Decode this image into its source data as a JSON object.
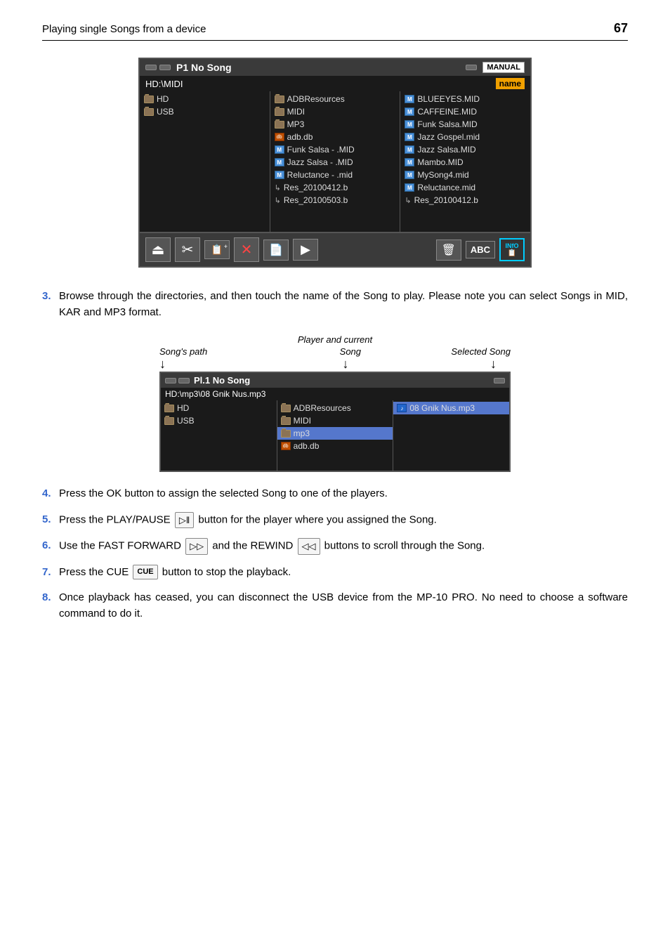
{
  "header": {
    "title": "Playing single Songs from a device",
    "page_number": "67"
  },
  "device_panel": {
    "top_bar": {
      "title": "P1 No Song",
      "manual": "MANUAL"
    },
    "path": "HD:\\MIDI",
    "name_badge": "name",
    "col1": [
      {
        "type": "folder",
        "label": "HD"
      },
      {
        "type": "folder",
        "label": "USB"
      }
    ],
    "col2": [
      {
        "type": "folder",
        "label": "ADBResources"
      },
      {
        "type": "folder",
        "label": "MIDI"
      },
      {
        "type": "folder",
        "label": "MP3"
      },
      {
        "type": "db",
        "label": "adb.db"
      },
      {
        "type": "mid",
        "label": "Funk Salsa - .MID"
      },
      {
        "type": "mid",
        "label": "Jazz Salsa - .MID"
      },
      {
        "type": "mid",
        "label": "Reluctance - .mid"
      },
      {
        "type": "sub",
        "label": "Res_20100412.b"
      },
      {
        "type": "sub",
        "label": "Res_20100503.b"
      }
    ],
    "col3": [
      {
        "type": "mid",
        "label": "BLUEEYES.MID"
      },
      {
        "type": "mid",
        "label": "CAFFEINE.MID"
      },
      {
        "type": "mid",
        "label": "Funk Salsa.MID"
      },
      {
        "type": "mid",
        "label": "Jazz Gospel.mid"
      },
      {
        "type": "mid",
        "label": "Jazz Salsa.MID"
      },
      {
        "type": "mid",
        "label": "Mambo.MID"
      },
      {
        "type": "mid",
        "label": "MySong4.mid"
      },
      {
        "type": "mid",
        "label": "Reluctance.mid"
      },
      {
        "type": "sub",
        "label": "Res_20100412.b"
      }
    ],
    "toolbar": {
      "info_label": "INFO"
    }
  },
  "step3": {
    "number": "3.",
    "text": "Browse through the directories, and then touch the name of the Song to play. Please note you can select Songs in MID, KAR and MP3 format."
  },
  "diagram": {
    "label_song_path": "Song's path",
    "label_top": "Player and current",
    "label_song": "Song",
    "label_selected": "Selected Song"
  },
  "mini_panel": {
    "title": "Pl.1  No Song",
    "path": "HD:\\mp3\\08 Gnik Nus.mp3",
    "col1": [
      {
        "type": "folder",
        "label": "HD"
      },
      {
        "type": "folder",
        "label": "USB"
      }
    ],
    "col2": [
      {
        "type": "folder",
        "label": "ADBResources"
      },
      {
        "type": "folder",
        "label": "MIDI"
      },
      {
        "type": "folder",
        "label": "mp3"
      },
      {
        "type": "db",
        "label": "adb.db"
      }
    ],
    "col3": [
      {
        "type": "mp3",
        "label": "08 Gnik Nus.mp3"
      }
    ]
  },
  "steps": [
    {
      "number": "4.",
      "text": "Press the OK button to assign the selected Song to one of the players."
    },
    {
      "number": "5.",
      "text": "Press the PLAY/PAUSE (▷‖) button for the player where you assigned the Song."
    },
    {
      "number": "6.",
      "text": "Use the FAST FORWARD (▷▷) and the REWIND (◁◁) buttons to scroll through the Song."
    },
    {
      "number": "7.",
      "text": "Press the CUE (CUE) button to stop the playback."
    },
    {
      "number": "8.",
      "text": "Once playback has ceased, you can disconnect the USB device from the MP-10 PRO. No need to choose a software command to do it."
    }
  ]
}
